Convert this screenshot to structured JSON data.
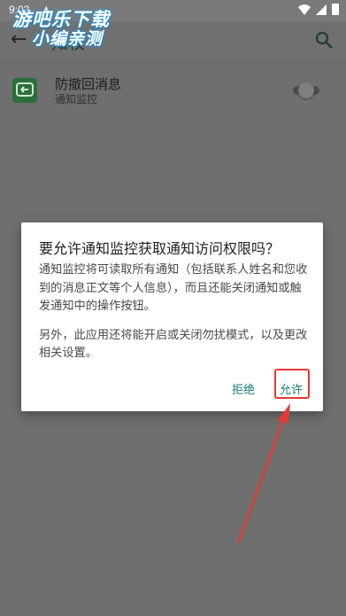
{
  "status_bar": {
    "time": "9:02",
    "alert_icon": "warning-icon"
  },
  "watermark": {
    "line1": "游吧乐下载",
    "line2": "小编亲测"
  },
  "app_bar": {
    "title": "知权",
    "back_icon": "arrow-back-icon",
    "search_icon": "search-icon"
  },
  "app_row": {
    "name": "防撤回消息",
    "subtitle": "通知监控",
    "toggle_state": "off"
  },
  "dialog": {
    "title": "要允许通知监控获取通知访问权限吗？",
    "paragraph1": "通知监控将可读取所有通知（包括联系人姓名和您收到的消息正文等个人信息），而且还能关闭通知或触发通知中的操作按钮。",
    "paragraph2": "另外，此应用还将能开启或关闭勿扰模式，以及更改相关设置。",
    "deny_label": "拒绝",
    "allow_label": "允许"
  },
  "colors": {
    "accent": "#157a72",
    "highlight": "#e53935"
  }
}
